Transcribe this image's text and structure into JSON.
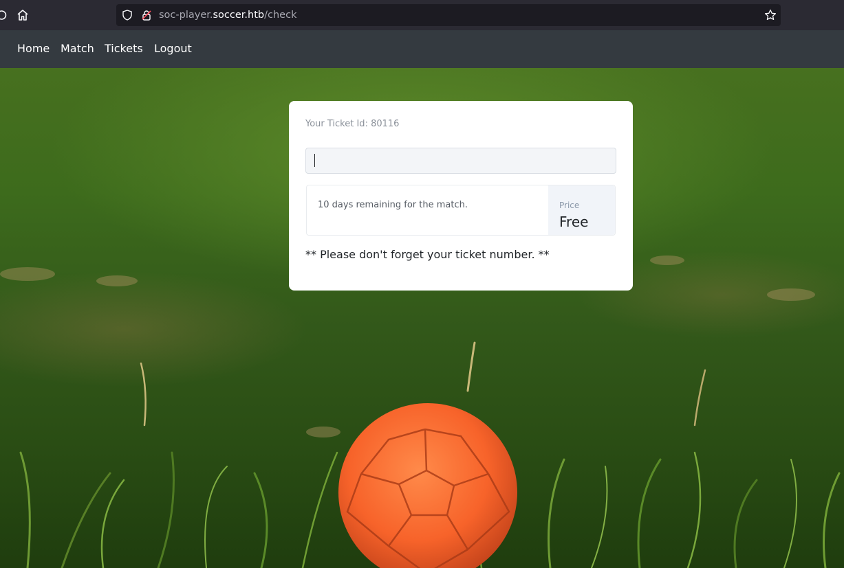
{
  "browser": {
    "url_prefix": "soc-player.",
    "url_host": "soccer.htb",
    "url_path": "/check",
    "icons": [
      "reload-icon",
      "home-icon",
      "shield-icon",
      "lock-icon",
      "star-icon"
    ]
  },
  "navbar": {
    "items": [
      {
        "label": "Home"
      },
      {
        "label": "Match"
      },
      {
        "label": "Tickets"
      },
      {
        "label": "Logout"
      }
    ]
  },
  "ticket": {
    "id_text": "Your Ticket Id: 80116",
    "input_value": "",
    "remaining_text": "10 days remaining for the match.",
    "price_label": "Price",
    "price_value": "Free",
    "reminder": "** Please don't forget your ticket number. **"
  },
  "colors": {
    "navbar_bg": "#343a40",
    "card_bg": "#ffffff",
    "ball": "#ff6a2a",
    "grass": "#3d6b1c"
  }
}
